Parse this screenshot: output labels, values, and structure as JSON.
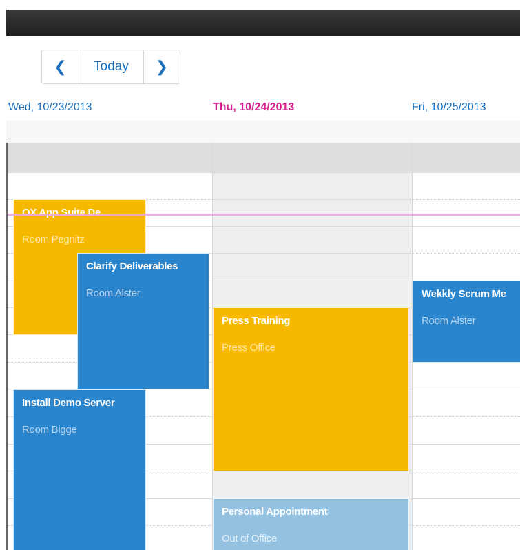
{
  "toolbar": {
    "prev_icon": "chevron-left-icon",
    "today_label": "Today",
    "next_icon": "chevron-right-icon"
  },
  "days": [
    {
      "label": "Wed, 10/23/2013",
      "is_today": false
    },
    {
      "label": "Thu, 10/24/2013",
      "is_today": true
    },
    {
      "label": "Fri, 10/25/2013",
      "is_today": false
    }
  ],
  "appointments": [
    {
      "title": "OX App Suite De...",
      "location": "Room Pegnitz",
      "color": "#f7b900"
    },
    {
      "title": "Clarify Deliverables",
      "location": "Room Alster",
      "color": "#2b85cd"
    },
    {
      "title": "Install Demo Server",
      "location": "Room Bigge",
      "color": "#2b85cd"
    },
    {
      "title": "Press Training",
      "location": "Press Office",
      "color": "#f7b900"
    },
    {
      "title": "Personal Appointment",
      "location": "Out of Office",
      "color": "#95c1e1"
    },
    {
      "title": "Wekkly Scrum Me",
      "location": "Room Alster",
      "color": "#2b85cd"
    }
  ],
  "colors": {
    "accent": "#1a6fbd",
    "today_header": "#d4208f",
    "current_time_line": "#e6a3dd"
  }
}
